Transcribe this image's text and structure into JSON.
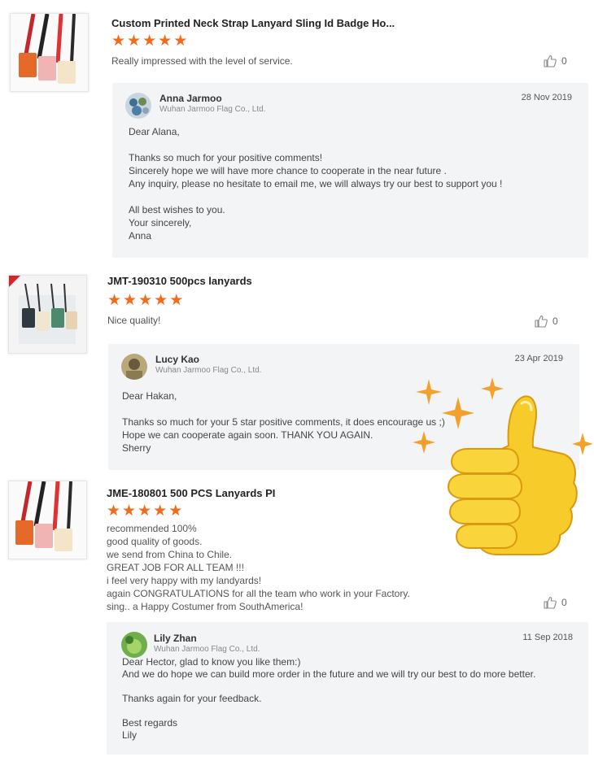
{
  "reviews": [
    {
      "product_title": "Custom Printed Neck Strap Lanyard Sling Id Badge Ho...",
      "rating": 5,
      "comment": [
        "Really impressed with the level of service."
      ],
      "likes": "0",
      "reply": {
        "name": "Anna Jarmoo",
        "company": "Wuhan Jarmoo Flag Co., Ltd.",
        "date": "28 Nov 2019",
        "lines": [
          "Dear Alana,",
          "",
          "Thanks so much for your positive comments!",
          "Sincerely hope we will have more chance to cooperate in the near future .",
          "Any inquiry, please no hesitate to email me, we will always try our best to support you !",
          "",
          "All best wishes to you.",
          "Your sincerely,",
          "Anna"
        ]
      }
    },
    {
      "product_title": "JMT-190310 500pcs lanyards",
      "rating": 5,
      "comment": [
        "Nice quality!"
      ],
      "likes": "0",
      "reply": {
        "name": "Lucy Kao",
        "company": "Wuhan Jarmoo Flag Co., Ltd.",
        "date": "23 Apr 2019",
        "lines": [
          "Dear Hakan,",
          "",
          "Thanks so much for your 5 star positive comments, it  does encourage us ;)",
          "Hope we can cooperate again soon.  THANK YOU AGAIN.",
          "Sherry"
        ]
      }
    },
    {
      "product_title": "JME-180801 500 PCS Lanyards PI",
      "rating": 5,
      "comment": [
        "recommended 100%",
        "good quality of goods.",
        "we send from China to Chile.",
        "GREAT JOB FOR ALL TEAM !!!",
        "i feel very happy with my landyards!",
        "again CONGRATULATIONS for all the team who work in your Factory.",
        "sing.. a Happy Costumer from SouthAmerica!"
      ],
      "likes": "0",
      "reply": {
        "name": "Lily Zhan",
        "company": "Wuhan Jarmoo Flag Co., Ltd.",
        "date": "11 Sep 2018",
        "lines": [
          "Dear Hector, glad to know you like them:)",
          "And we do hope we can build more order in the future and we will try our best to do more better.",
          "",
          "Thanks again for your feedback.",
          "",
          "Best regards",
          "Lily"
        ]
      }
    }
  ],
  "icons": {
    "like": "thumbs-up-icon",
    "star": "star-icon"
  },
  "colors": {
    "star": "#f26b1d",
    "reply_bg": "#f3f4f6",
    "thumb_sticker": "#f7cc2a"
  }
}
